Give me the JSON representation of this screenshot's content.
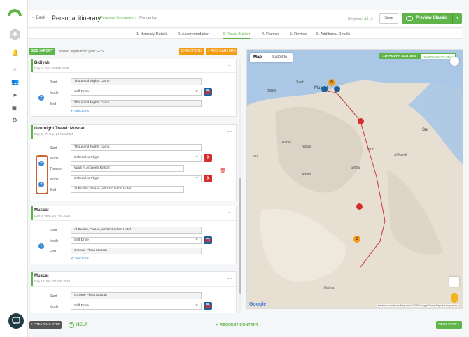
{
  "header": {
    "back_label": "Back",
    "title": "Personal itinerary",
    "breadcrumb_parent": "Personal Itineraries",
    "breadcrumb_sep": ">",
    "breadcrumb_current": "Wonderlust",
    "regions_label": "Regions:",
    "regions_value": "All",
    "save_label": "Save",
    "preview_label": "Preview Classic"
  },
  "steps": [
    {
      "label": "1. Itinerary Details"
    },
    {
      "label": "2. Accommodation"
    },
    {
      "label": "3. Route Builder"
    },
    {
      "label": "4. Planner"
    },
    {
      "label": "5. Review"
    },
    {
      "label": "6. Additional Details"
    }
  ],
  "toolbar": {
    "gds_label": "GDS IMPORT",
    "gds_note": "Import flights from your GDS",
    "directions_label": "DIRECTIONS",
    "car_hire_label": "+ ADD CAR HIRE"
  },
  "cards": [
    {
      "title": "Bidiyah",
      "sub": "Day 6: Tue, 24 Feb 2026",
      "start_label": "Start",
      "start": "Thousand Nights Camp",
      "mode_label": "Mode",
      "mode": "Self Drive",
      "end_label": "End",
      "end": "Thousand Nights Camp",
      "directions": "directions"
    },
    {
      "title": "Overnight Travel: Muscat",
      "sub": "Day 6 - 7: Tue, 24 Feb 2026",
      "start_label": "Start",
      "start": "Thousand Nights Camp",
      "mode_label": "Mode",
      "mode": "Scheduled Flight",
      "transfer_label": "Transfer",
      "transfer": "Wadi Al Arbaeen Resort",
      "mode2_label": "Mode",
      "mode2": "Scheduled Flight",
      "end_label": "End",
      "end": "Al Bustan Palace, a Ritz-Carlton Hotel"
    },
    {
      "title": "Muscat",
      "sub": "Day 9: Wed, 25 Feb 2026",
      "start_label": "Start",
      "start": "Al Bustan Palace, a Ritz-Carlton Hotel",
      "mode_label": "Mode",
      "mode": "Self Drive",
      "end_label": "End",
      "end": "Crowne Plaza Muscat",
      "directions": "directions"
    },
    {
      "title": "Muscat",
      "sub": "Day 12: Sat, 28 Feb 2026",
      "start_label": "Start",
      "start": "Crowne Plaza Muscat",
      "mode_label": "Mode",
      "mode": "Self Drive"
    }
  ],
  "map": {
    "map_label": "Map",
    "satellite_label": "Satellite",
    "auto_view": "AUTOMATIC MAP VIEW",
    "custom_view": "CUSTOM MAP VIEW",
    "places": [
      {
        "name": "Muscat",
        "big": true
      },
      {
        "name": "Seeb"
      },
      {
        "name": "Barka"
      },
      {
        "name": "Nizwa"
      },
      {
        "name": "Bahla"
      },
      {
        "name": "Adam"
      },
      {
        "name": "Sur"
      },
      {
        "name": "Ibra"
      },
      {
        "name": "Ibri"
      },
      {
        "name": "Al Kamil"
      },
      {
        "name": "Sinaw"
      },
      {
        "name": "Haima"
      }
    ],
    "marker_d": "D",
    "marker_c": "C",
    "google": "Google",
    "attribution": "Keyboard shortcuts   Map data ©2026 Google   Terms   Report a map error"
  },
  "footer": {
    "prev_label": "< PREVIOUS STEP",
    "help_label": "HELP",
    "request_label": "✓ REQUEST CONTENT",
    "next_label": "NEXT STEP >"
  },
  "colors": {
    "brand": "#5fb54a",
    "accent": "#f39c12",
    "flight": "#d62e2e",
    "drive": "#1f5f9a"
  }
}
